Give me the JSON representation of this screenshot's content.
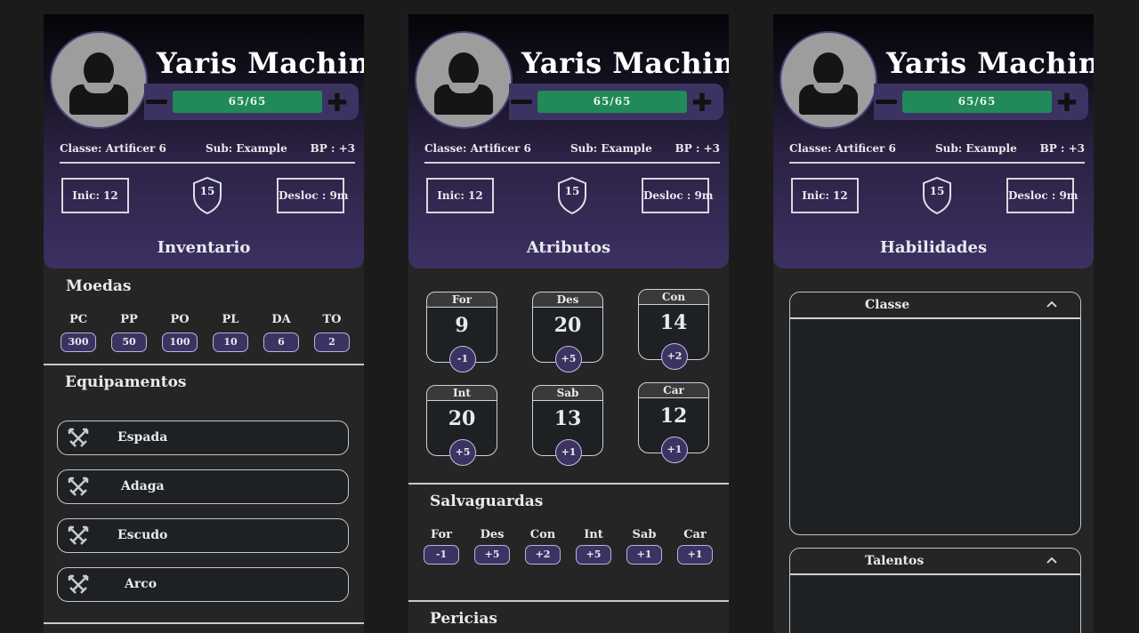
{
  "character": {
    "name": "Yaris Machine",
    "hp": "65/65",
    "class": "Classe: Artificer 6",
    "subclass": "Sub: Example",
    "bp": "BP : +3",
    "initiative": "Inic: 12",
    "armor_class": "15",
    "speed": "Desloc : 9m"
  },
  "panels": {
    "inventory_title": "Inventario",
    "attributes_title": "Atributos",
    "abilities_title": "Habilidades"
  },
  "inventory": {
    "coins_title": "Moedas",
    "coins": [
      {
        "label": "PC",
        "value": "300"
      },
      {
        "label": "PP",
        "value": "50"
      },
      {
        "label": "PO",
        "value": "100"
      },
      {
        "label": "PL",
        "value": "10"
      },
      {
        "label": "DA",
        "value": "6"
      },
      {
        "label": "TO",
        "value": "2"
      }
    ],
    "equipment_title": "Equipamentos",
    "equipment": [
      {
        "name": "Espada",
        "icon": "crossed-swords-icon"
      },
      {
        "name": "Adaga",
        "icon": "crossed-swords-icon"
      },
      {
        "name": "Escudo",
        "icon": "crossed-swords-icon"
      },
      {
        "name": "Arco",
        "icon": "crossed-swords-icon"
      }
    ]
  },
  "attributes": {
    "scores": [
      {
        "label": "For",
        "value": "9",
        "mod": "-1"
      },
      {
        "label": "Des",
        "value": "20",
        "mod": "+5"
      },
      {
        "label": "Con",
        "value": "14",
        "mod": "+2"
      },
      {
        "label": "Int",
        "value": "20",
        "mod": "+5"
      },
      {
        "label": "Sab",
        "value": "13",
        "mod": "+1"
      },
      {
        "label": "Car",
        "value": "12",
        "mod": "+1"
      }
    ],
    "saves_title": "Salvaguardas",
    "saves": [
      {
        "label": "For",
        "value": "-1"
      },
      {
        "label": "Des",
        "value": "+5"
      },
      {
        "label": "Con",
        "value": "+2"
      },
      {
        "label": "Int",
        "value": "+5"
      },
      {
        "label": "Sab",
        "value": "+1"
      },
      {
        "label": "Car",
        "value": "+1"
      }
    ],
    "skills_title": "Pericias"
  },
  "abilities": {
    "sections": [
      {
        "title": "Classe"
      },
      {
        "title": "Talentos"
      }
    ]
  },
  "colors": {
    "accent": "#3d3363",
    "hp_green": "#21895a",
    "panel_bg": "#252525",
    "page_bg": "#1b1b1b"
  }
}
